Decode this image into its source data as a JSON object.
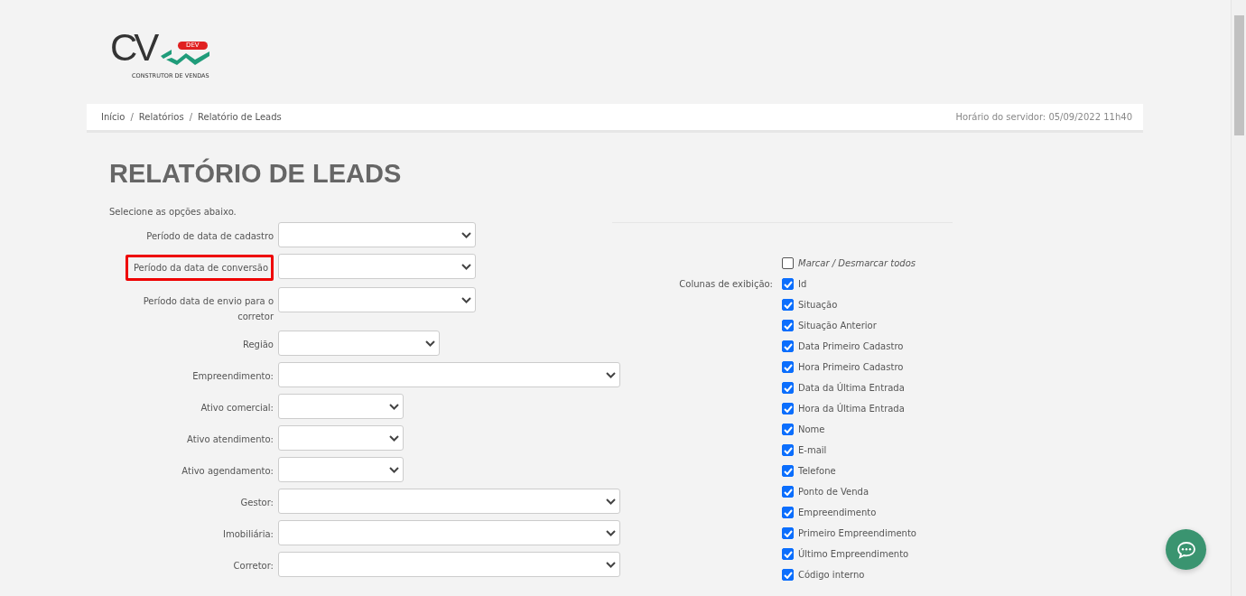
{
  "logo": {
    "letters": "CV",
    "badge": "DEV",
    "tagline": "CONSTRUTOR DE VENDAS"
  },
  "breadcrumb": [
    "Início",
    "Relatórios",
    "Relatório de Leads"
  ],
  "breadcrumb_separator": "/",
  "server_time": "Horário do servidor: 05/09/2022 11h40",
  "title": "RELATÓRIO DE LEADS",
  "instructions": "Selecione as opções abaixo.",
  "fields": [
    {
      "label": "Período de data de cadastro",
      "kind": "medium",
      "highlighted": false
    },
    {
      "label": "Período da data de conversão",
      "kind": "medium",
      "highlighted": true
    },
    {
      "label": "Período data de envio para o corretor",
      "kind": "medium",
      "highlighted": false
    },
    {
      "label": "Região",
      "kind": "region",
      "highlighted": false
    },
    {
      "label": "Empreendimento:",
      "kind": "wide",
      "highlighted": false
    },
    {
      "label": "Ativo comercial:",
      "kind": "short",
      "highlighted": false
    },
    {
      "label": "Ativo atendimento:",
      "kind": "short",
      "highlighted": false
    },
    {
      "label": "Ativo agendamento:",
      "kind": "short",
      "highlighted": false
    },
    {
      "label": "Gestor:",
      "kind": "wide",
      "highlighted": false
    },
    {
      "label": "Imobiliária:",
      "kind": "wide",
      "highlighted": false
    },
    {
      "label": "Corretor:",
      "kind": "wide",
      "highlighted": false
    }
  ],
  "toggle_all": {
    "label": "Marcar / Desmarcar todos",
    "checked": false
  },
  "columns_label": "Colunas de exibição:",
  "columns": [
    {
      "label": "Id",
      "checked": true
    },
    {
      "label": "Situação",
      "checked": true
    },
    {
      "label": "Situação Anterior",
      "checked": true
    },
    {
      "label": "Data Primeiro Cadastro",
      "checked": true
    },
    {
      "label": "Hora Primeiro Cadastro",
      "checked": true
    },
    {
      "label": "Data da Última Entrada",
      "checked": true
    },
    {
      "label": "Hora da Última Entrada",
      "checked": true
    },
    {
      "label": "Nome",
      "checked": true
    },
    {
      "label": "E-mail",
      "checked": true
    },
    {
      "label": "Telefone",
      "checked": true
    },
    {
      "label": "Ponto de Venda",
      "checked": true
    },
    {
      "label": "Empreendimento",
      "checked": true
    },
    {
      "label": "Primeiro Empreendimento",
      "checked": true
    },
    {
      "label": "Último Empreendimento",
      "checked": true
    },
    {
      "label": "Código interno",
      "checked": true
    }
  ]
}
